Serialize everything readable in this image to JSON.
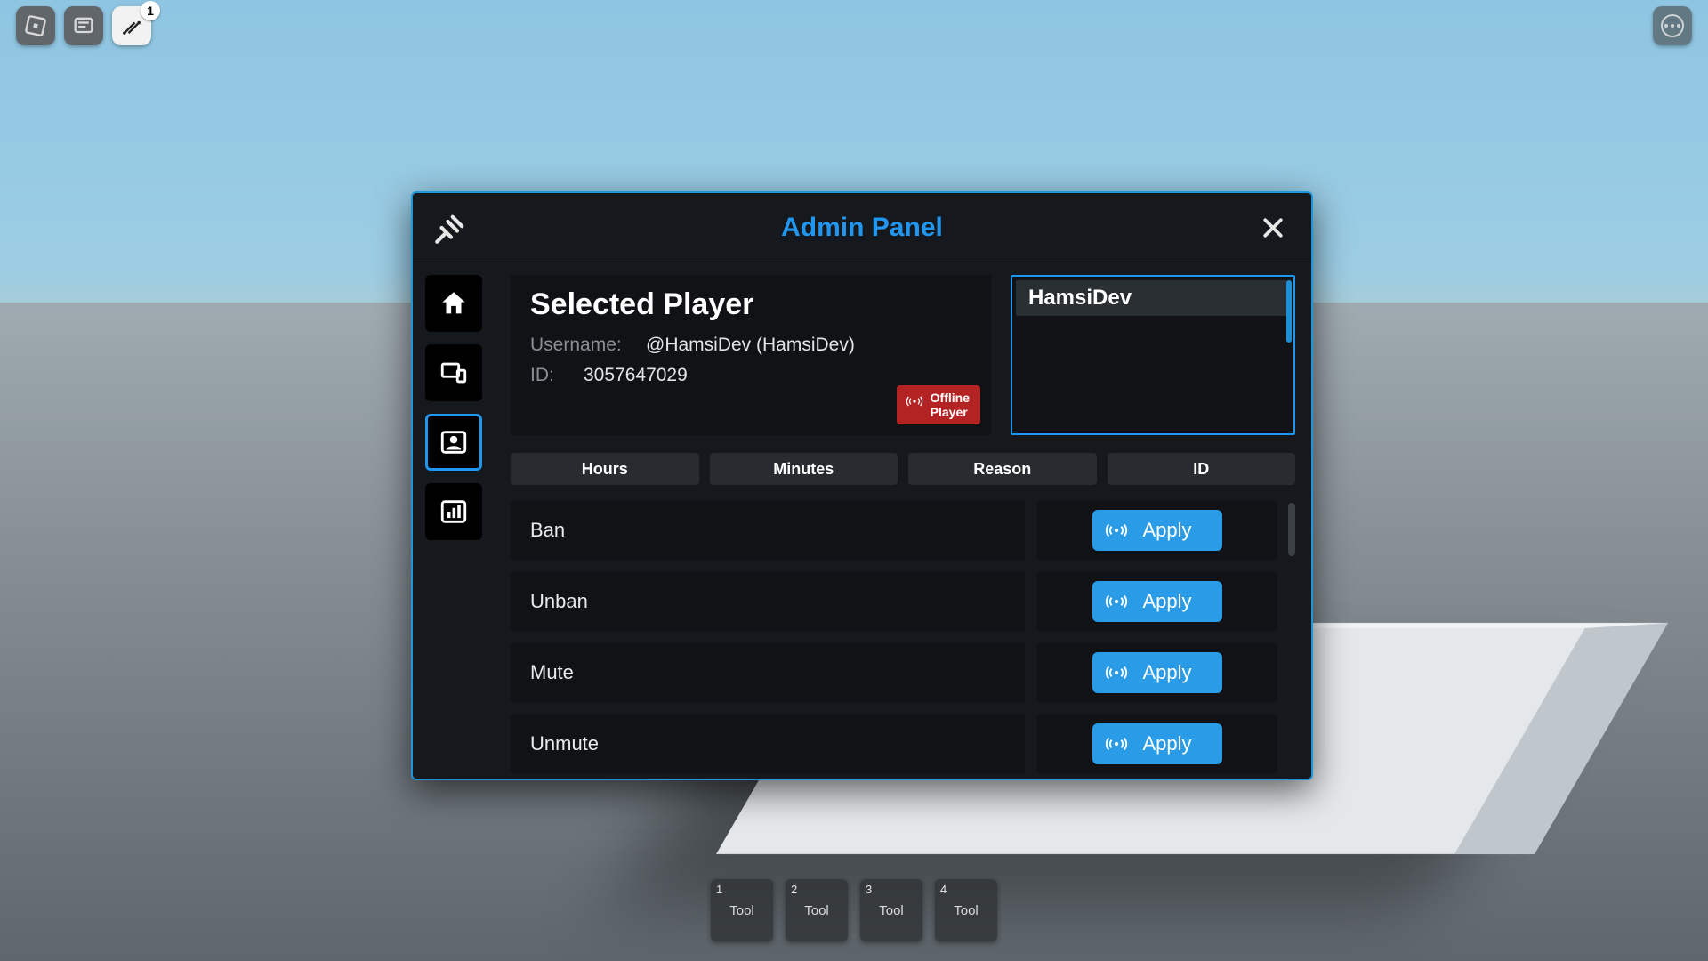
{
  "topbar": {
    "badge": "1"
  },
  "hotbar": [
    {
      "num": "1",
      "label": "Tool"
    },
    {
      "num": "2",
      "label": "Tool"
    },
    {
      "num": "3",
      "label": "Tool"
    },
    {
      "num": "4",
      "label": "Tool"
    }
  ],
  "panel": {
    "title": "Admin Panel",
    "selected": {
      "heading": "Selected Player",
      "username_label": "Username:",
      "username_value": "@HamsiDev (HamsiDev)",
      "id_label": "ID:",
      "id_value": "3057647029",
      "offline_line1": "Offline",
      "offline_line2": "Player"
    },
    "player_list": [
      "HamsiDev"
    ],
    "filters": [
      "Hours",
      "Minutes",
      "Reason",
      "ID"
    ],
    "actions": [
      {
        "name": "Ban",
        "apply": "Apply"
      },
      {
        "name": "Unban",
        "apply": "Apply"
      },
      {
        "name": "Mute",
        "apply": "Apply"
      },
      {
        "name": "Unmute",
        "apply": "Apply"
      }
    ]
  }
}
